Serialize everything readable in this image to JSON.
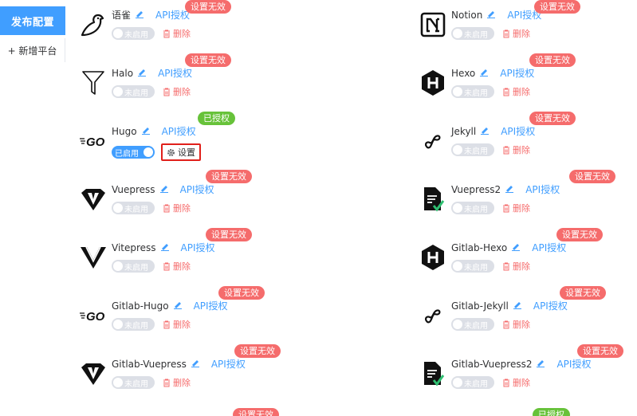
{
  "sidebar": {
    "active_label": "发布配置",
    "add_label": "+ 新增平台"
  },
  "labels": {
    "api": "API授权",
    "delete": "删除",
    "disabled": "未启用",
    "enabled": "已启用",
    "settings": "设置",
    "invalid": "设置无效",
    "authorized": "已授权"
  },
  "colors": {
    "primary": "#409eff",
    "danger": "#f56c6c",
    "success": "#67c23a",
    "highlight_border": "#e0201b"
  },
  "platforms": [
    {
      "name": "语雀",
      "icon": "yuque-bird-icon",
      "status": "设置无效",
      "enabled": false
    },
    {
      "name": "Notion",
      "icon": "notion-icon",
      "status": "设置无效",
      "enabled": false
    },
    {
      "name": "Halo",
      "icon": "halo-funnel-icon",
      "status": "设置无效",
      "enabled": false
    },
    {
      "name": "Hexo",
      "icon": "hexo-hexagon-icon",
      "status": "设置无效",
      "enabled": false
    },
    {
      "name": "Hugo",
      "icon": "go-logo-icon",
      "status": "已授权",
      "enabled": true
    },
    {
      "name": "Jekyll",
      "icon": "jekyll-icon",
      "status": "设置无效",
      "enabled": false
    },
    {
      "name": "Vuepress",
      "icon": "vuepress-icon",
      "status": "设置无效",
      "enabled": false
    },
    {
      "name": "Vuepress2",
      "icon": "vuepress2-doc-icon",
      "status": "设置无效",
      "enabled": false
    },
    {
      "name": "Vitepress",
      "icon": "vitepress-icon",
      "status": "设置无效",
      "enabled": false
    },
    {
      "name": "Gitlab-Hexo",
      "icon": "hexo-hexagon-icon",
      "status": "设置无效",
      "enabled": false
    },
    {
      "name": "Gitlab-Hugo",
      "icon": "go-logo-icon",
      "status": "设置无效",
      "enabled": false
    },
    {
      "name": "Gitlab-Jekyll",
      "icon": "jekyll-icon",
      "status": "设置无效",
      "enabled": false
    },
    {
      "name": "Gitlab-Vuepress",
      "icon": "vuepress-icon",
      "status": "设置无效",
      "enabled": false
    },
    {
      "name": "Gitlab-Vuepress2",
      "icon": "vuepress2-doc-icon",
      "status": "设置无效",
      "enabled": false
    }
  ],
  "partial_badges": [
    "设置无效",
    "已授权"
  ]
}
